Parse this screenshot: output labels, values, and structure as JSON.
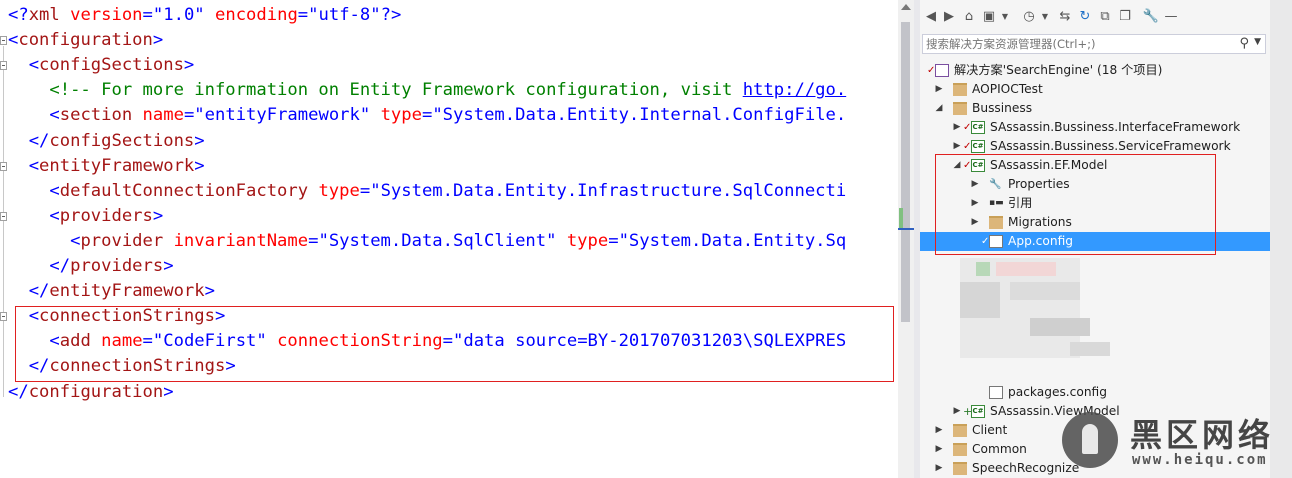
{
  "editor": {
    "lines": [
      [
        {
          "t": "<?",
          "c": "blue"
        },
        {
          "t": "xml",
          "c": "brown"
        },
        {
          "t": " version",
          "c": "red"
        },
        {
          "t": "=",
          "c": "blue"
        },
        {
          "t": "\"1.0\"",
          "c": "blue"
        },
        {
          "t": " encoding",
          "c": "red"
        },
        {
          "t": "=",
          "c": "blue"
        },
        {
          "t": "\"utf-8\"",
          "c": "blue"
        },
        {
          "t": "?>",
          "c": "blue"
        }
      ],
      [
        {
          "t": "<",
          "c": "blue"
        },
        {
          "t": "configuration",
          "c": "brown"
        },
        {
          "t": ">",
          "c": "blue"
        }
      ],
      [
        {
          "t": "  <",
          "c": "blue"
        },
        {
          "t": "configSections",
          "c": "brown"
        },
        {
          "t": ">",
          "c": "blue"
        }
      ],
      [
        {
          "t": "    <!-- For more information on Entity Framework configuration, visit ",
          "c": "green"
        },
        {
          "t": "http://go.",
          "c": "link"
        }
      ],
      [
        {
          "t": "    <",
          "c": "blue"
        },
        {
          "t": "section",
          "c": "brown"
        },
        {
          "t": " name",
          "c": "red"
        },
        {
          "t": "=",
          "c": "blue"
        },
        {
          "t": "\"entityFramework\"",
          "c": "blue"
        },
        {
          "t": " type",
          "c": "red"
        },
        {
          "t": "=",
          "c": "blue"
        },
        {
          "t": "\"System.Data.Entity.Internal.ConfigFile.",
          "c": "blue"
        }
      ],
      [
        {
          "t": "  </",
          "c": "blue"
        },
        {
          "t": "configSections",
          "c": "brown"
        },
        {
          "t": ">",
          "c": "blue"
        }
      ],
      [
        {
          "t": "  <",
          "c": "blue"
        },
        {
          "t": "entityFramework",
          "c": "brown"
        },
        {
          "t": ">",
          "c": "blue"
        }
      ],
      [
        {
          "t": "    <",
          "c": "blue"
        },
        {
          "t": "defaultConnectionFactory",
          "c": "brown"
        },
        {
          "t": " type",
          "c": "red"
        },
        {
          "t": "=",
          "c": "blue"
        },
        {
          "t": "\"System.Data.Entity.Infrastructure.SqlConnecti",
          "c": "blue"
        }
      ],
      [
        {
          "t": "    <",
          "c": "blue"
        },
        {
          "t": "providers",
          "c": "brown"
        },
        {
          "t": ">",
          "c": "blue"
        }
      ],
      [
        {
          "t": "      <",
          "c": "blue"
        },
        {
          "t": "provider",
          "c": "brown"
        },
        {
          "t": " invariantName",
          "c": "red"
        },
        {
          "t": "=",
          "c": "blue"
        },
        {
          "t": "\"System.Data.SqlClient\"",
          "c": "blue"
        },
        {
          "t": " type",
          "c": "red"
        },
        {
          "t": "=",
          "c": "blue"
        },
        {
          "t": "\"System.Data.Entity.Sq",
          "c": "blue"
        }
      ],
      [
        {
          "t": "    </",
          "c": "blue"
        },
        {
          "t": "providers",
          "c": "brown"
        },
        {
          "t": ">",
          "c": "blue"
        }
      ],
      [
        {
          "t": "  </",
          "c": "blue"
        },
        {
          "t": "entityFramework",
          "c": "brown"
        },
        {
          "t": ">",
          "c": "blue"
        }
      ],
      [
        {
          "t": "  <",
          "c": "blue"
        },
        {
          "t": "connectionStrings",
          "c": "brown"
        },
        {
          "t": ">",
          "c": "blue"
        }
      ],
      [
        {
          "t": "    <",
          "c": "blue"
        },
        {
          "t": "add",
          "c": "brown"
        },
        {
          "t": " name",
          "c": "red"
        },
        {
          "t": "=",
          "c": "blue"
        },
        {
          "t": "\"CodeFirst\"",
          "c": "blue"
        },
        {
          "t": " connectionString",
          "c": "red"
        },
        {
          "t": "=",
          "c": "blue"
        },
        {
          "t": "\"data source=BY-201707031203\\SQLEXPRES",
          "c": "blue"
        }
      ],
      [
        {
          "t": "  </",
          "c": "blue"
        },
        {
          "t": "connectionStrings",
          "c": "brown"
        },
        {
          "t": ">",
          "c": "blue"
        }
      ],
      [
        {
          "t": "</",
          "c": "blue"
        },
        {
          "t": "configuration",
          "c": "brown"
        },
        {
          "t": ">",
          "c": "blue"
        }
      ]
    ]
  },
  "solution_explorer": {
    "search_placeholder": "搜索解决方案资源管理器(Ctrl+;)",
    "tree": [
      {
        "label": "解决方案'SearchEngine' (18 个项目)",
        "icon": "solution",
        "depth": 0,
        "arrow": "",
        "check": true
      },
      {
        "label": "AOPIOCTest",
        "icon": "folder",
        "depth": 1,
        "arrow": "▶"
      },
      {
        "label": "Bussiness",
        "icon": "folder",
        "depth": 1,
        "arrow": "◢"
      },
      {
        "label": "SAssassin.Bussiness.InterfaceFramework",
        "icon": "project",
        "depth": 2,
        "arrow": "▶",
        "check": true
      },
      {
        "label": "SAssassin.Bussiness.ServiceFramework",
        "icon": "project",
        "depth": 2,
        "arrow": "▶",
        "check": true
      },
      {
        "label": "SAssassin.EF.Model",
        "icon": "project",
        "depth": 2,
        "arrow": "◢",
        "check": true
      },
      {
        "label": "Properties",
        "icon": "wrench",
        "depth": 3,
        "arrow": "▶"
      },
      {
        "label": "引用",
        "icon": "reference",
        "depth": 3,
        "arrow": "▶"
      },
      {
        "label": "Migrations",
        "icon": "folder",
        "depth": 3,
        "arrow": "▶"
      },
      {
        "label": "App.config",
        "icon": "file",
        "depth": 3,
        "arrow": "",
        "check": true,
        "selected": true
      },
      {
        "label": "packages.config",
        "icon": "file",
        "depth": 3,
        "arrow": "",
        "row": 17
      },
      {
        "label": "SAssassin.ViewModel",
        "icon": "project",
        "depth": 2,
        "arrow": "▶",
        "plus": true,
        "row": 18
      },
      {
        "label": "Client",
        "icon": "folder",
        "depth": 1,
        "arrow": "▶",
        "row": 19
      },
      {
        "label": "Common",
        "icon": "folder",
        "depth": 1,
        "arrow": "▶",
        "row": 20
      },
      {
        "label": "SpeechRecognize",
        "icon": "folder",
        "depth": 1,
        "arrow": "▶",
        "row": 21
      }
    ]
  },
  "watermark": {
    "text": "黑区网络",
    "url": "www.heiqu.com"
  }
}
